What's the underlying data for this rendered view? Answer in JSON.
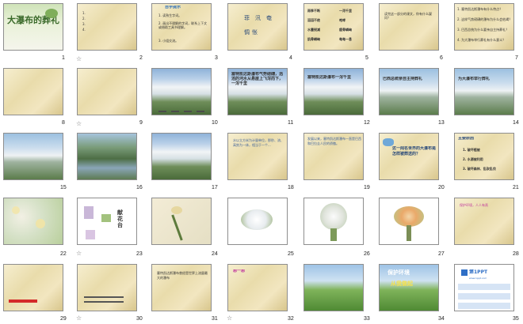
{
  "slides": [
    {
      "num": "1",
      "title": "大瀑布的葬礼"
    },
    {
      "num": "2",
      "lines": "1.\n2.\n3.\n4."
    },
    {
      "num": "3",
      "header": "自学提示",
      "items": [
        "1. 读熟生字词。",
        "2. 画出不理解的字词，联系上下文或借助工具书理解。",
        "3. 小组交流。"
      ]
    },
    {
      "num": "4",
      "words": [
        "菲",
        "汛",
        "奄",
        "惆",
        "怅"
      ]
    },
    {
      "num": "5",
      "grid": [
        "雨季不断",
        "一泻千里",
        "滔滔不绝",
        "咆哮",
        "水量锐减",
        "瘦骨嶙峋",
        "肌骨嶙峋",
        "奄奄一息"
      ]
    },
    {
      "num": "6",
      "text": "读完这一部分的课文，你有什么疑问？"
    },
    {
      "num": "7",
      "items": [
        "1. 塞特凯达斯瀑布有什么特点？",
        "2. 这样气势磅礴的瀑布为什么会枯竭？",
        "3. 巴西总统为什么要亲自主持葬礼？",
        "4. 为大瀑布举行葬礼有什么意义？"
      ]
    },
    {
      "num": "8"
    },
    {
      "num": "9"
    },
    {
      "num": "10"
    },
    {
      "num": "11",
      "text": "塞特凯达斯瀑布气势磅礴，滔滔的河水从悬崖上飞泻而下，一泻千里"
    },
    {
      "num": "12",
      "text": "塞特凯达斯瀑布一泻千里"
    },
    {
      "num": "13",
      "text": "巴西总统亲自主持葬礼"
    },
    {
      "num": "14",
      "text": "为大瀑布举行葬礼"
    },
    {
      "num": "15"
    },
    {
      "num": "16"
    },
    {
      "num": "17"
    },
    {
      "num": "18",
      "text": "水以立方米为计量单位，那秒、流、高势为一体，相当于一个..."
    },
    {
      "num": "19",
      "text": "发展以来，塞特凯达斯瀑布一直是巴西和巴拉圭人民的骄傲。"
    },
    {
      "num": "20",
      "text": "这一闻名世界的大瀑布是怎样被葬送的？"
    },
    {
      "num": "21",
      "header": "主要原因",
      "items": [
        "1. 破坏植被",
        "2. 水源被利用",
        "3. 破坏森林、乱砍乱伐"
      ]
    },
    {
      "num": "22"
    },
    {
      "num": "23",
      "title": "献花台"
    },
    {
      "num": "24"
    },
    {
      "num": "25"
    },
    {
      "num": "26"
    },
    {
      "num": "27"
    },
    {
      "num": "28",
      "text": "保护环境，人人有责"
    },
    {
      "num": "29"
    },
    {
      "num": "30"
    },
    {
      "num": "31",
      "text": "塞特凯达斯瀑布曾经是世界上流量最大的瀑布"
    },
    {
      "num": "32",
      "header": "想一想"
    },
    {
      "num": "33"
    },
    {
      "num": "34",
      "title": "保护环境",
      "subtitle": "从我做起"
    },
    {
      "num": "35",
      "title": "第1PPT",
      "subtitle": "www.1ppt.com"
    }
  ],
  "star": "☆"
}
